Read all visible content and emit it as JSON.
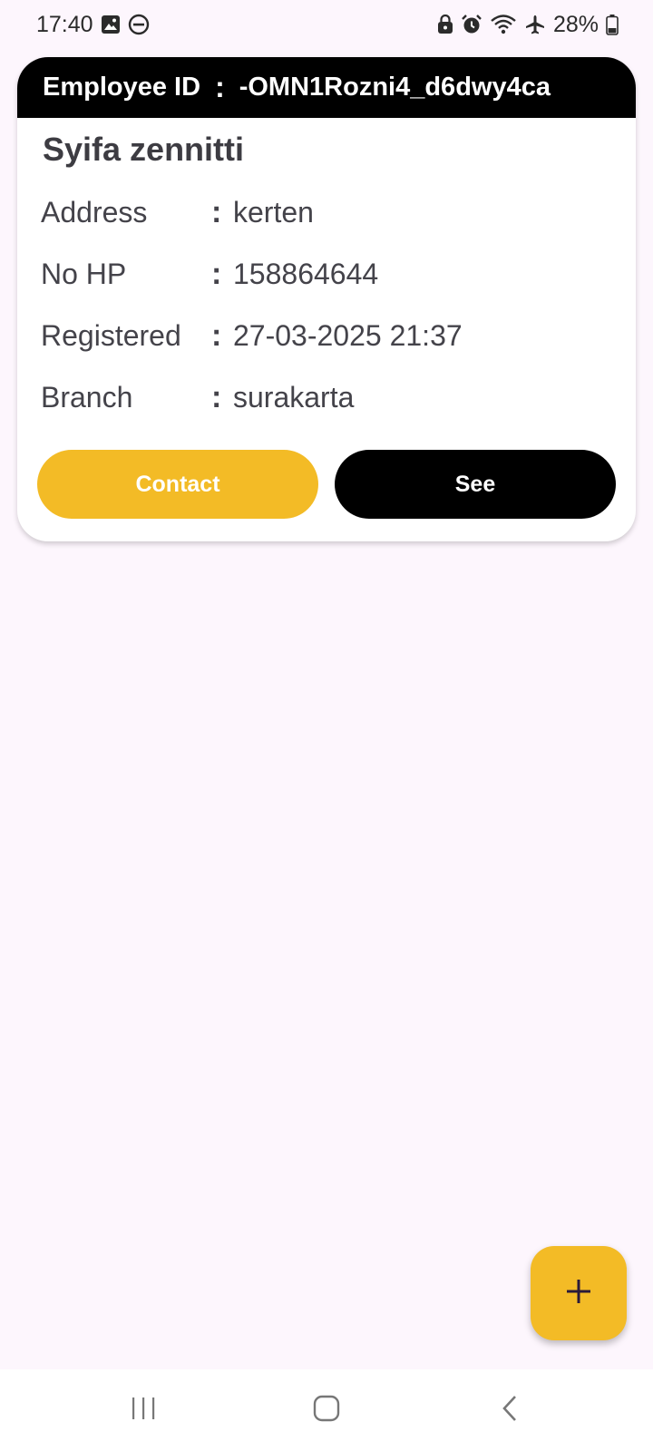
{
  "status_bar": {
    "time": "17:40",
    "battery": "28%",
    "icons_left": [
      "image-icon",
      "do-not-disturb-icon"
    ],
    "icons_right": [
      "lock-icon",
      "alarm-icon",
      "wifi-icon",
      "airplane-icon",
      "battery-icon"
    ]
  },
  "card": {
    "header_label": "Employee ID",
    "header_colon": ":",
    "employee_id": "-OMN1Rozni4_d6dwy4ca",
    "name": "Syifa zennitti",
    "rows": [
      {
        "label": "Address",
        "colon": ":",
        "value": "kerten"
      },
      {
        "label": "No HP",
        "colon": ":",
        "value": "158864644"
      },
      {
        "label": "Registered",
        "colon": ":",
        "value": "27-03-2025 21:37"
      },
      {
        "label": "Branch",
        "colon": ":",
        "value": "surakarta"
      }
    ],
    "contact_label": "Contact",
    "see_label": "See"
  },
  "fab": {
    "icon": "plus-icon"
  },
  "colors": {
    "accent": "#f3bb26",
    "header": "#000000",
    "background": "#fdf6fd"
  }
}
